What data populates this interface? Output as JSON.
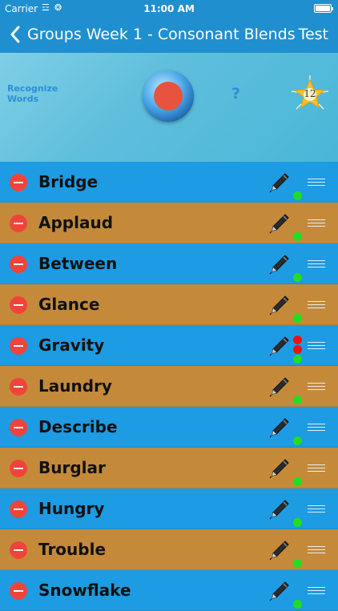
{
  "status": {
    "carrier": "Carrier",
    "time": "11:00 AM"
  },
  "nav": {
    "back_label": "Groups",
    "title": "Week 1 - Consonant Blends",
    "test_label": "Test"
  },
  "header": {
    "recognize_label": "Recognize Words",
    "help_label": "?",
    "star_count": "12"
  },
  "colors": {
    "blue_row": "#1d9be3",
    "tan_row": "#c48a3a",
    "status_green": "#22dd22",
    "status_red": "#ee1111"
  },
  "words": [
    {
      "label": "Bridge",
      "row_color": "blue",
      "status": [
        "green"
      ]
    },
    {
      "label": "Applaud",
      "row_color": "tan",
      "status": [
        "green"
      ]
    },
    {
      "label": "Between",
      "row_color": "blue",
      "status": [
        "green"
      ]
    },
    {
      "label": "Glance",
      "row_color": "tan",
      "status": [
        "green"
      ]
    },
    {
      "label": "Gravity",
      "row_color": "blue",
      "status": [
        "red",
        "red",
        "green"
      ]
    },
    {
      "label": "Laundry",
      "row_color": "tan",
      "status": [
        "green"
      ]
    },
    {
      "label": "Describe",
      "row_color": "blue",
      "status": [
        "green"
      ]
    },
    {
      "label": "Burglar",
      "row_color": "tan",
      "status": [
        "green"
      ]
    },
    {
      "label": "Hungry",
      "row_color": "blue",
      "status": [
        "green"
      ]
    },
    {
      "label": "Trouble",
      "row_color": "tan",
      "status": [
        "green"
      ]
    },
    {
      "label": "Snowflake",
      "row_color": "blue",
      "status": [
        "green"
      ]
    }
  ]
}
